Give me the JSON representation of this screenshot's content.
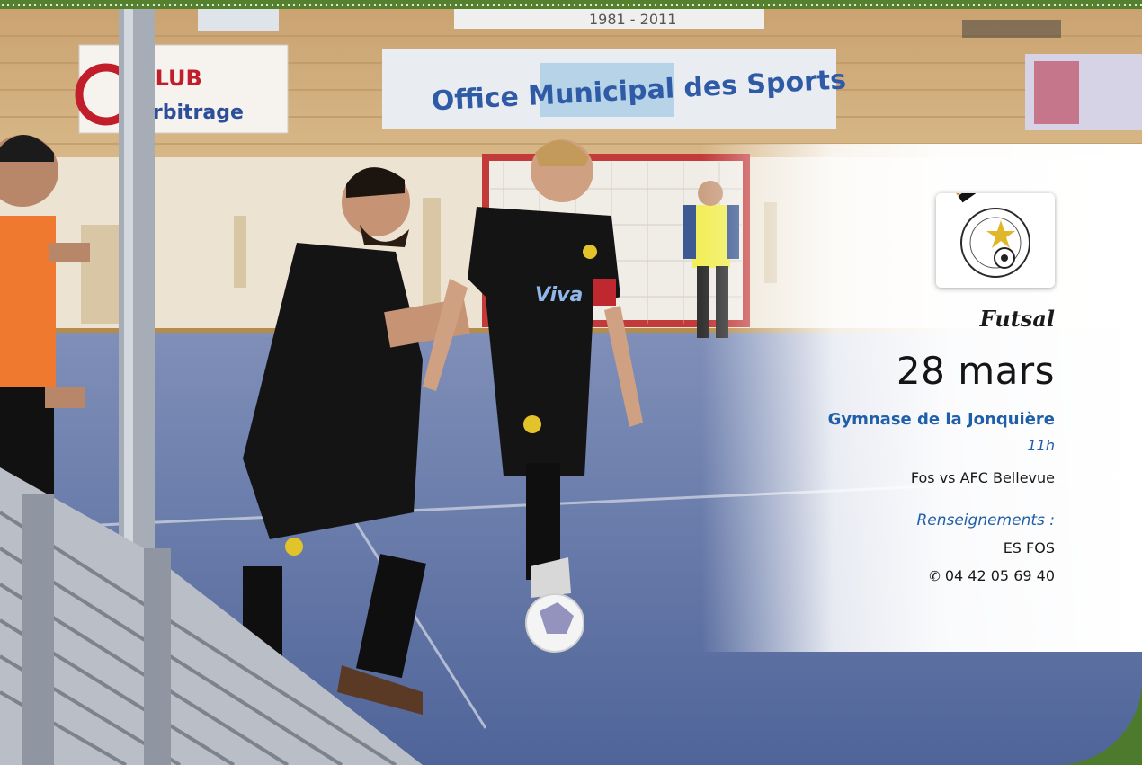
{
  "event": {
    "sport": "Futsal",
    "date": "28 mars",
    "venue": "Gymnase de la Jonquière",
    "time": "11h",
    "match": "Fos vs AFC Bellevue",
    "info_label": "Renseignements :",
    "info_org": "ES FOS",
    "phone_icon": "✆",
    "phone": "04 42 05 69 40"
  },
  "photo": {
    "banner_year": "1981 - 2011",
    "banner_oms": "Office Municipal des Sports",
    "banner_left_top": "CLUB",
    "banner_left_bottom": "arbitrage",
    "jersey_sponsor": "Viva"
  },
  "colors": {
    "accent_blue": "#1f5ea8",
    "frame_green": "#4d7a2c",
    "court_blue": "#5f74a6"
  }
}
